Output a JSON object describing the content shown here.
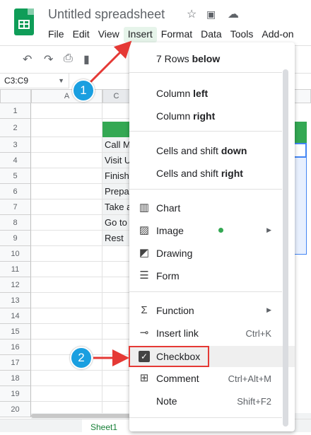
{
  "app": {
    "title": "Untitled spreadsheet",
    "menu": [
      "File",
      "Edit",
      "View",
      "Insert",
      "Format",
      "Data",
      "Tools",
      "Add-on"
    ],
    "active_menu": "Insert"
  },
  "namebox": {
    "value": "C3:C9"
  },
  "columns": {
    "a": "A",
    "c": "C"
  },
  "rows": [
    "1",
    "2",
    "3",
    "4",
    "5",
    "6",
    "7",
    "8",
    "9",
    "10",
    "11",
    "12",
    "13",
    "14",
    "15",
    "16",
    "17",
    "18",
    "19",
    "20"
  ],
  "cells_c": [
    "Call M",
    "Visit U",
    "Finish",
    "Prepa",
    "Take a",
    "Go to",
    "Rest"
  ],
  "insert_menu": {
    "rows_below": {
      "prefix": "7 Rows ",
      "bold": "below"
    },
    "column_left": {
      "prefix": "Column ",
      "bold": "left"
    },
    "column_right": {
      "prefix": "Column ",
      "bold": "right"
    },
    "cells_down": {
      "prefix": "Cells and shift ",
      "bold": "down"
    },
    "cells_right": {
      "prefix": "Cells and shift ",
      "bold": "right"
    },
    "chart": "Chart",
    "image": "Image",
    "drawing": "Drawing",
    "form": "Form",
    "function": "Function",
    "insert_link": {
      "label": "Insert link",
      "shortcut": "Ctrl+K"
    },
    "checkbox": "Checkbox",
    "comment": {
      "label": "Comment",
      "shortcut": "Ctrl+Alt+M"
    },
    "note": {
      "label": "Note",
      "shortcut": "Shift+F2"
    }
  },
  "callouts": [
    "1",
    "2"
  ],
  "sheet_tab": "Sheet1",
  "colors": {
    "accent_green": "#34a853",
    "callout_blue": "#1a9fe0",
    "arrow_red": "#e53935"
  }
}
